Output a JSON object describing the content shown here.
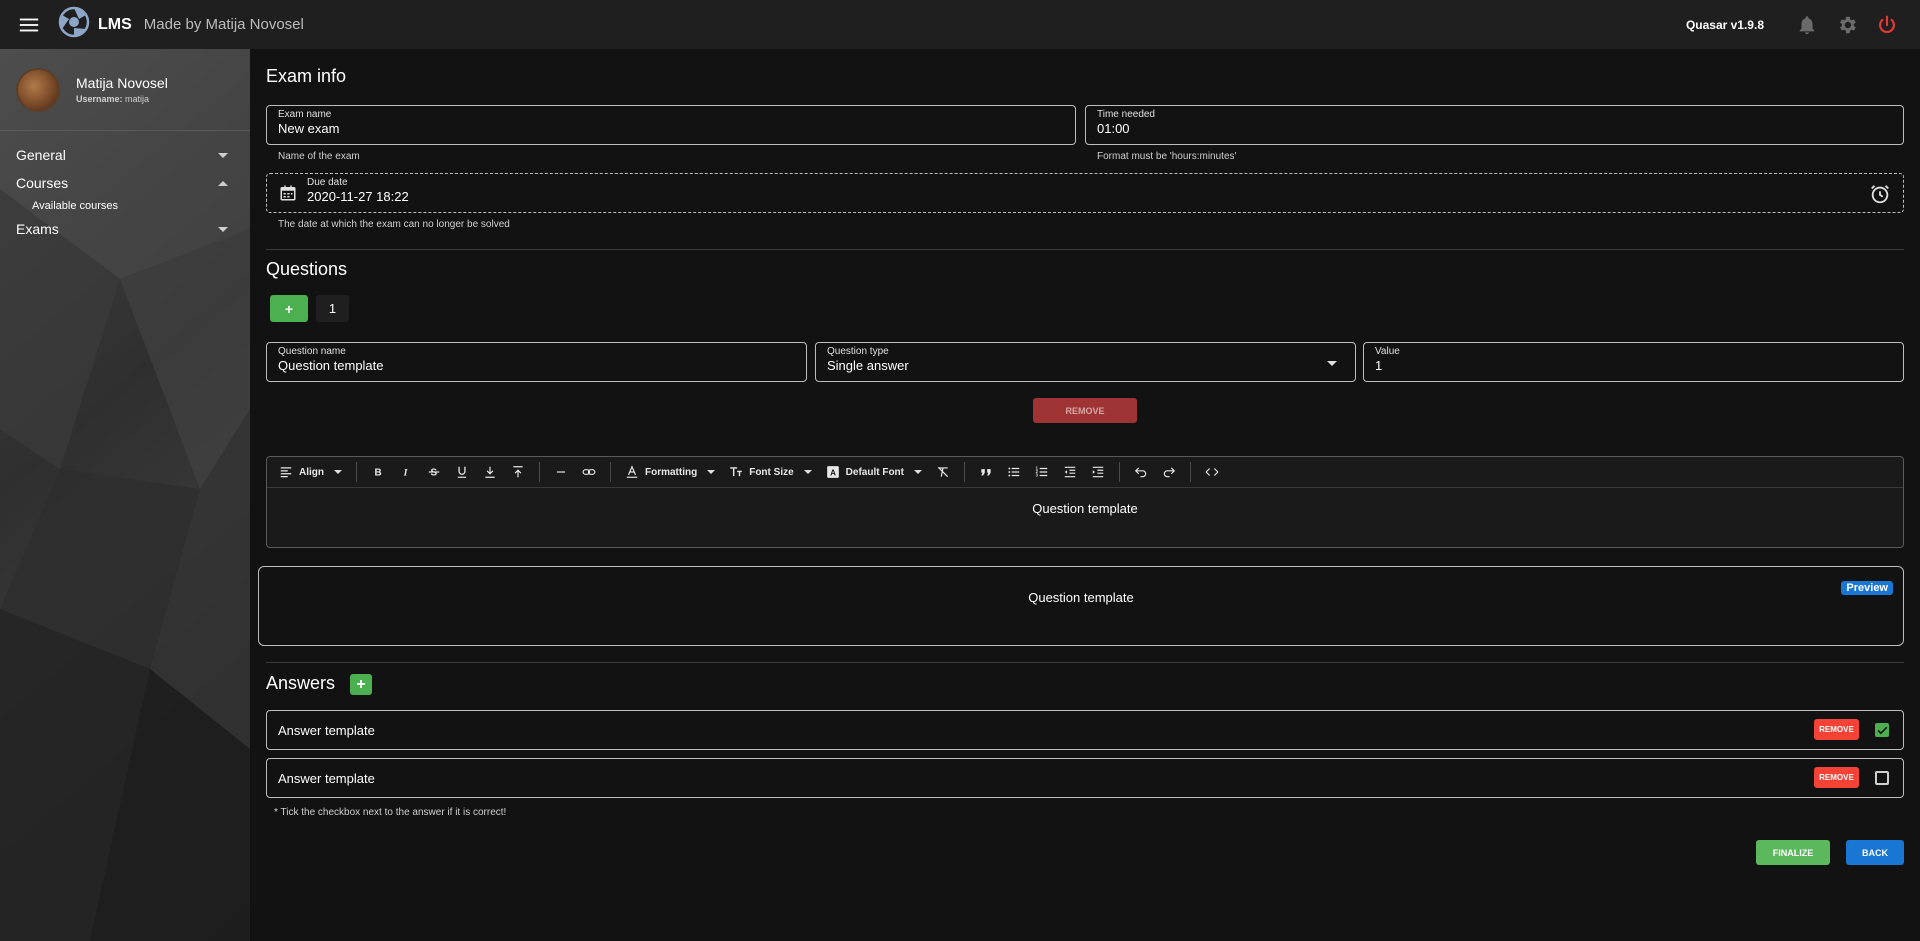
{
  "header": {
    "app_name": "LMS",
    "app_subtitle": "Made by Matija Novosel",
    "version": "Quasar v1.9.8"
  },
  "sidebar": {
    "profile": {
      "name": "Matija Novosel",
      "username_label": "Username:",
      "username": "matija"
    },
    "items": [
      {
        "label": "General"
      },
      {
        "label": "Courses",
        "sub": [
          "Available courses"
        ]
      },
      {
        "label": "Exams"
      }
    ]
  },
  "exam_info": {
    "title": "Exam info",
    "exam_name": {
      "label": "Exam name",
      "value": "New exam",
      "hint": "Name of the exam"
    },
    "time_needed": {
      "label": "Time needed",
      "value": "01:00",
      "hint": "Format must be 'hours:minutes'"
    },
    "due_date": {
      "label": "Due date",
      "value": "2020-11-27 18:22",
      "hint": "The date at which the exam can no longer be solved"
    }
  },
  "questions": {
    "title": "Questions",
    "add_label": "+",
    "page_number": "1",
    "question_name": {
      "label": "Question name",
      "value": "Question template"
    },
    "question_type": {
      "label": "Question type",
      "value": "Single answer"
    },
    "value": {
      "label": "Value",
      "value": "1"
    },
    "remove_label": "REMOVE"
  },
  "editor": {
    "toolbar": {
      "align": "Align",
      "formatting": "Formatting",
      "font_size": "Font Size",
      "default_font": "Default Font"
    },
    "content": "Question template"
  },
  "preview": {
    "content": "Question template",
    "badge": "Preview"
  },
  "answers": {
    "title": "Answers",
    "add_label": "+",
    "items": [
      {
        "text": "Answer template",
        "remove_label": "REMOVE",
        "correct": true
      },
      {
        "text": "Answer template",
        "remove_label": "REMOVE",
        "correct": false
      }
    ],
    "note": "* Tick the checkbox next to the answer if it is correct!"
  },
  "actions": {
    "finalize": "FINALIZE",
    "back": "BACK"
  },
  "colors": {
    "green": "#4caf50",
    "red": "#f44336",
    "blue": "#1976d2",
    "dim_red": "#9e3434",
    "background": "#121212"
  }
}
